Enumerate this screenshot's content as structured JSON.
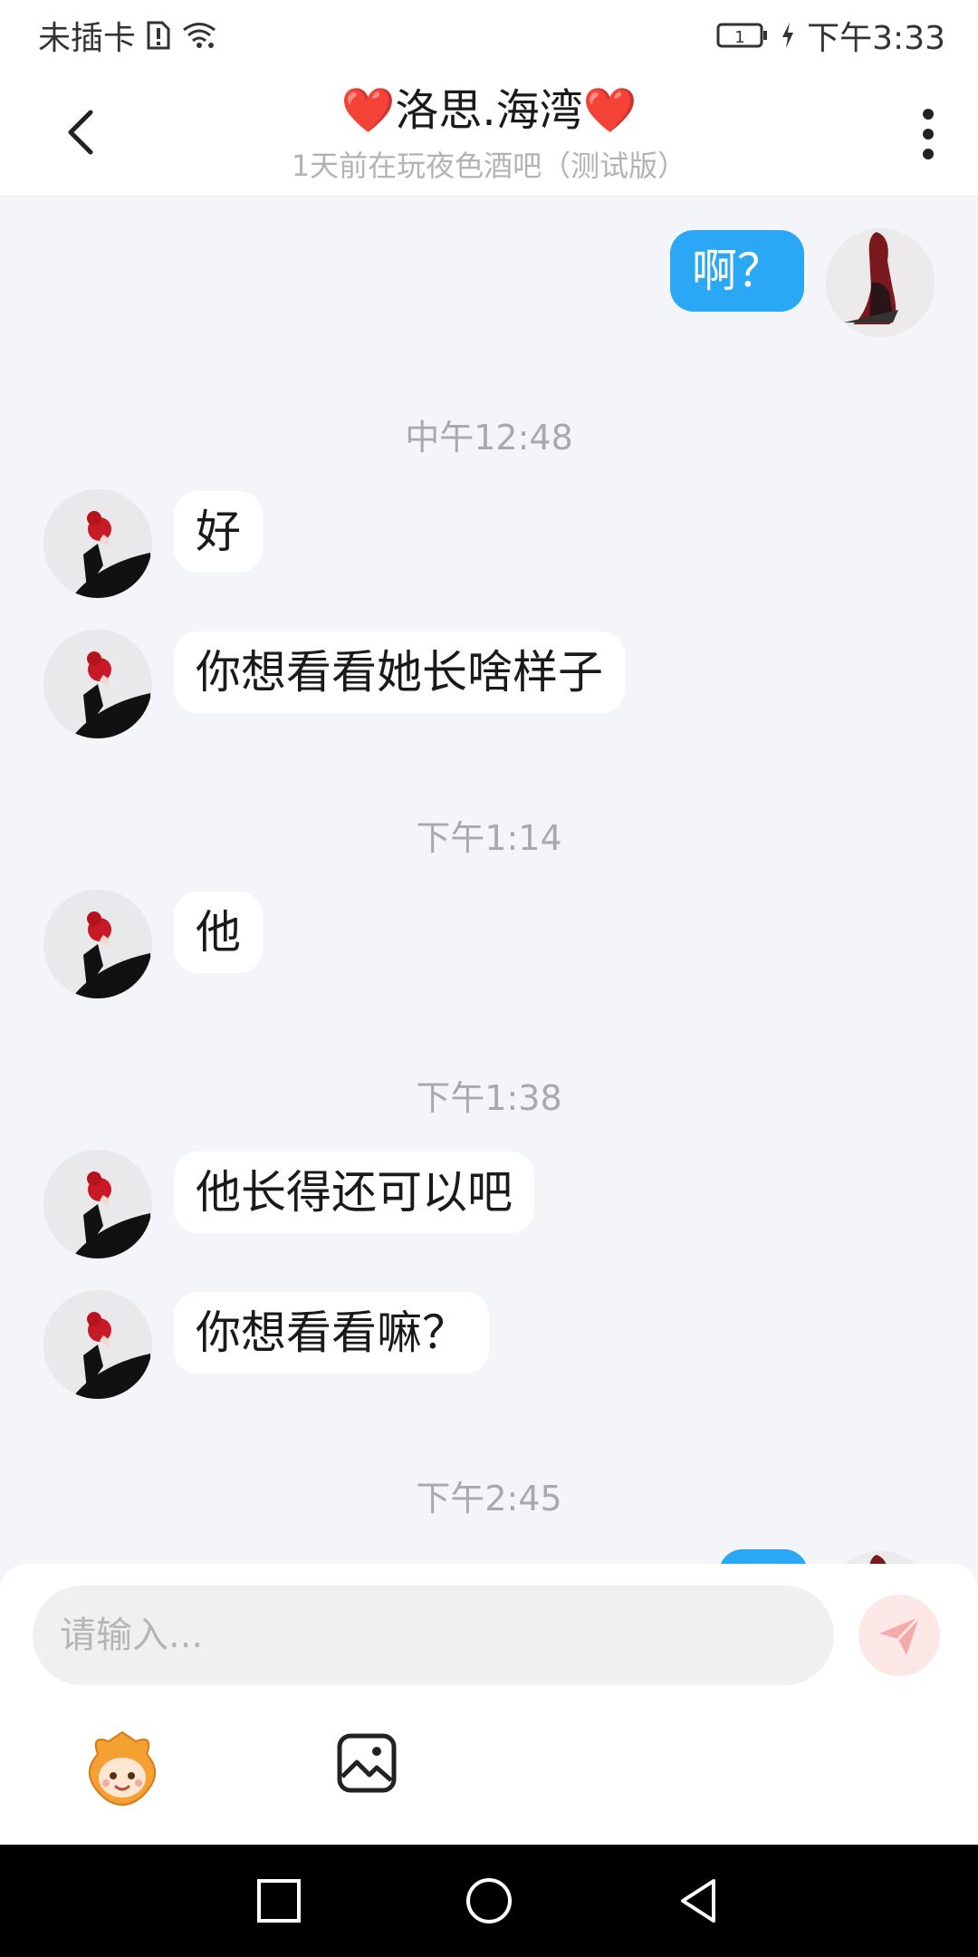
{
  "status_bar": {
    "carrier": "未插卡",
    "sim_slot": "1",
    "time": "下午3:33"
  },
  "header": {
    "title": "❤️洛思.海湾❤️",
    "subtitle": "1天前在玩夜色酒吧（测试版）"
  },
  "messages": [
    {
      "type": "text",
      "direction": "out",
      "text": "啊？"
    },
    {
      "type": "time",
      "text": "中午12:48"
    },
    {
      "type": "text",
      "direction": "in",
      "text": "好"
    },
    {
      "type": "text",
      "direction": "in",
      "text": "你想看看她长啥样子"
    },
    {
      "type": "time",
      "text": "下午1:14"
    },
    {
      "type": "text",
      "direction": "in",
      "text": "他"
    },
    {
      "type": "time",
      "text": "下午1:38"
    },
    {
      "type": "text",
      "direction": "in",
      "text": "他长得还可以吧"
    },
    {
      "type": "text",
      "direction": "in",
      "text": "你想看看嘛？"
    },
    {
      "type": "time",
      "text": "下午2:45"
    }
  ],
  "composer": {
    "placeholder": "请输入...",
    "value": ""
  },
  "colors": {
    "outgoing_bubble": "#2aa8f5",
    "incoming_bubble": "#ffffff",
    "chat_background": "#f3f5f9",
    "send_button_bg": "#fde7e7",
    "send_icon": "#f6a9a9"
  },
  "icons": [
    "back-arrow-icon",
    "more-vertical-icon",
    "wifi-icon",
    "sim-alert-icon",
    "battery-icon",
    "charging-icon",
    "send-icon",
    "emoji-icon",
    "image-icon",
    "nav-recents-icon",
    "nav-home-icon",
    "nav-back-icon"
  ]
}
